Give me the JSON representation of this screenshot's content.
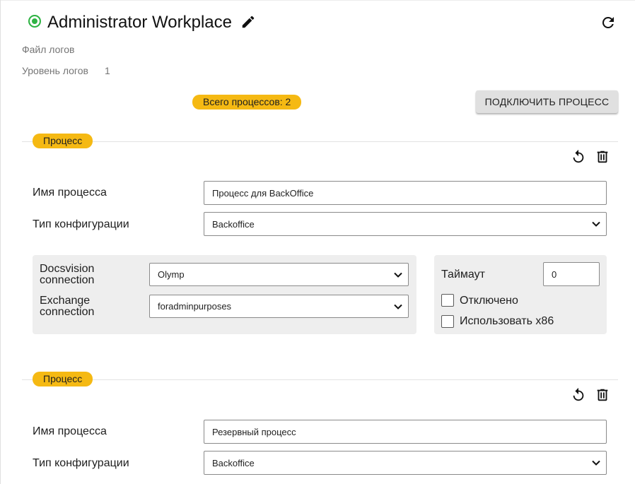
{
  "header": {
    "title": "Administrator Workplace",
    "status_color": "#2fb344",
    "status_icon": "status-online-icon",
    "edit_icon": "pencil-icon",
    "refresh_icon": "refresh-icon"
  },
  "meta": {
    "log_file_label": "Файл логов",
    "log_level_label": "Уровень логов",
    "log_level_value": "1"
  },
  "toolbar": {
    "total_processes": "Всего процессов: 2",
    "connect_button": "ПОДКЛЮЧИТЬ ПРОЦЕСС"
  },
  "accent_color": "#f5b913",
  "processes": [
    {
      "badge": "Процесс",
      "restart_icon": "restart-icon",
      "delete_icon": "trash-icon",
      "name_label": "Имя процесса",
      "name_value": "Процесс для BackOffice",
      "config_label": "Тип конфигурации",
      "config_value": "Backoffice",
      "docsvision_label_1": "Docsvision",
      "docsvision_label_2": "connection",
      "docsvision_value": "Olymp",
      "exchange_label_1": "Exchange",
      "exchange_label_2": "connection",
      "exchange_value": "foradminpurposes",
      "timeout_label": "Таймаут",
      "timeout_value": "0",
      "disabled_label": "Отключено",
      "x86_label": "Использовать x86"
    },
    {
      "badge": "Процесс",
      "restart_icon": "restart-icon",
      "delete_icon": "trash-icon",
      "name_label": "Имя процесса",
      "name_value": "Резервный процесс",
      "config_label": "Тип конфигурации",
      "config_value": "Backoffice"
    }
  ]
}
